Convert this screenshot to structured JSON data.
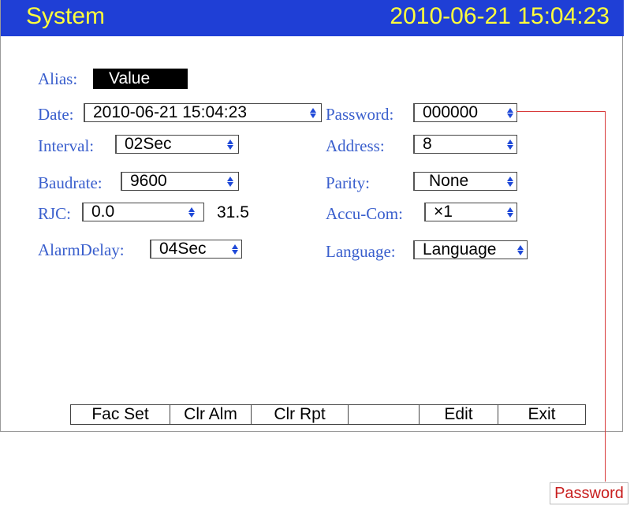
{
  "header": {
    "title": "System",
    "datetime": "2010-06-21 15:04:23"
  },
  "fields": {
    "alias": {
      "label": "Alias:",
      "value": "Value"
    },
    "date": {
      "label": "Date:",
      "value": "2010-06-21 15:04:23"
    },
    "password": {
      "label": "Password:",
      "value": "000000"
    },
    "interval": {
      "label": "Interval:",
      "value": "02Sec"
    },
    "address": {
      "label": "Address:",
      "value": "8"
    },
    "baudrate": {
      "label": "Baudrate:",
      "value": "9600"
    },
    "parity": {
      "label": "Parity:",
      "value": "None"
    },
    "rjc": {
      "label": "RJC:",
      "value": "0.0",
      "reading": "31.5"
    },
    "accu_com": {
      "label": "Accu-Com:",
      "value": "×1"
    },
    "alarm_delay": {
      "label": "AlarmDelay:",
      "value": "04Sec"
    },
    "language": {
      "label": "Language:",
      "value": "Language"
    }
  },
  "softkeys": [
    "Fac Set",
    "Clr Alm",
    "Clr Rpt",
    "",
    "Edit",
    "Exit"
  ],
  "callout": {
    "label": "Password"
  },
  "colors": {
    "title_bar": "#1f3fd6",
    "title_text": "#ffff3c",
    "label_text": "#3a5fcd",
    "spinner": "#1f49d8",
    "callout": "#d83a3a"
  }
}
